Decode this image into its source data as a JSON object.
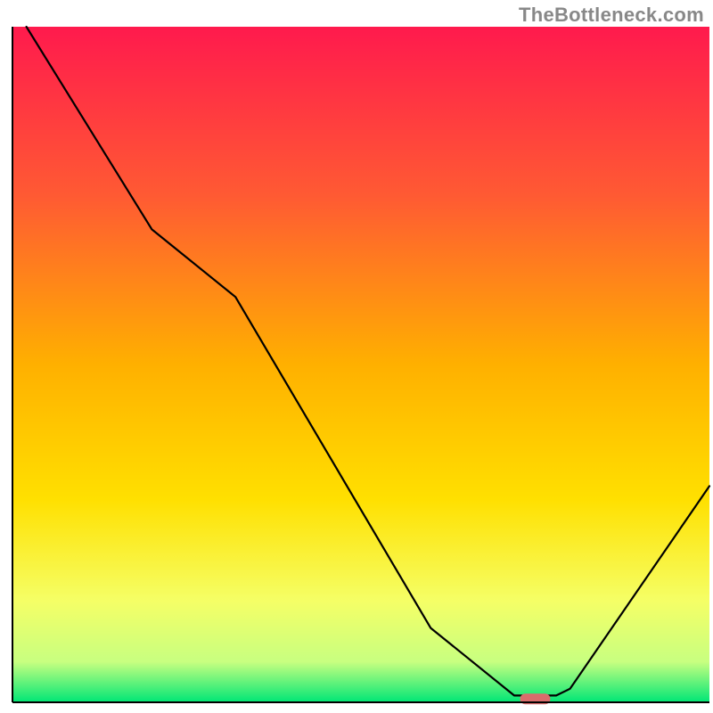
{
  "watermark": "TheBottleneck.com",
  "chart_data": {
    "type": "line",
    "title": "",
    "xlabel": "",
    "ylabel": "",
    "xlim": [
      0,
      100
    ],
    "ylim": [
      0,
      100
    ],
    "axes_visible": false,
    "grid": false,
    "background": {
      "type": "vertical_gradient",
      "stops": [
        {
          "offset": 0.0,
          "color": "#ff1a4d"
        },
        {
          "offset": 0.25,
          "color": "#ff5a33"
        },
        {
          "offset": 0.5,
          "color": "#ffb000"
        },
        {
          "offset": 0.7,
          "color": "#ffe000"
        },
        {
          "offset": 0.85,
          "color": "#f5ff66"
        },
        {
          "offset": 0.94,
          "color": "#c8ff80"
        },
        {
          "offset": 1.0,
          "color": "#00e676"
        }
      ]
    },
    "series": [
      {
        "name": "bottleneck-curve",
        "type": "line",
        "color": "#000000",
        "x": [
          2,
          20,
          32,
          60,
          72,
          78,
          80,
          100
        ],
        "values": [
          100,
          70,
          60,
          11,
          1,
          1,
          2,
          32
        ]
      }
    ],
    "marker": {
      "name": "optimal-point",
      "x": 75,
      "y": 0.5,
      "color": "#d96c6c",
      "shape": "rounded-rect"
    },
    "frame": {
      "visible": true,
      "color": "#000000",
      "width": 2,
      "sides": [
        "left",
        "bottom"
      ]
    }
  }
}
